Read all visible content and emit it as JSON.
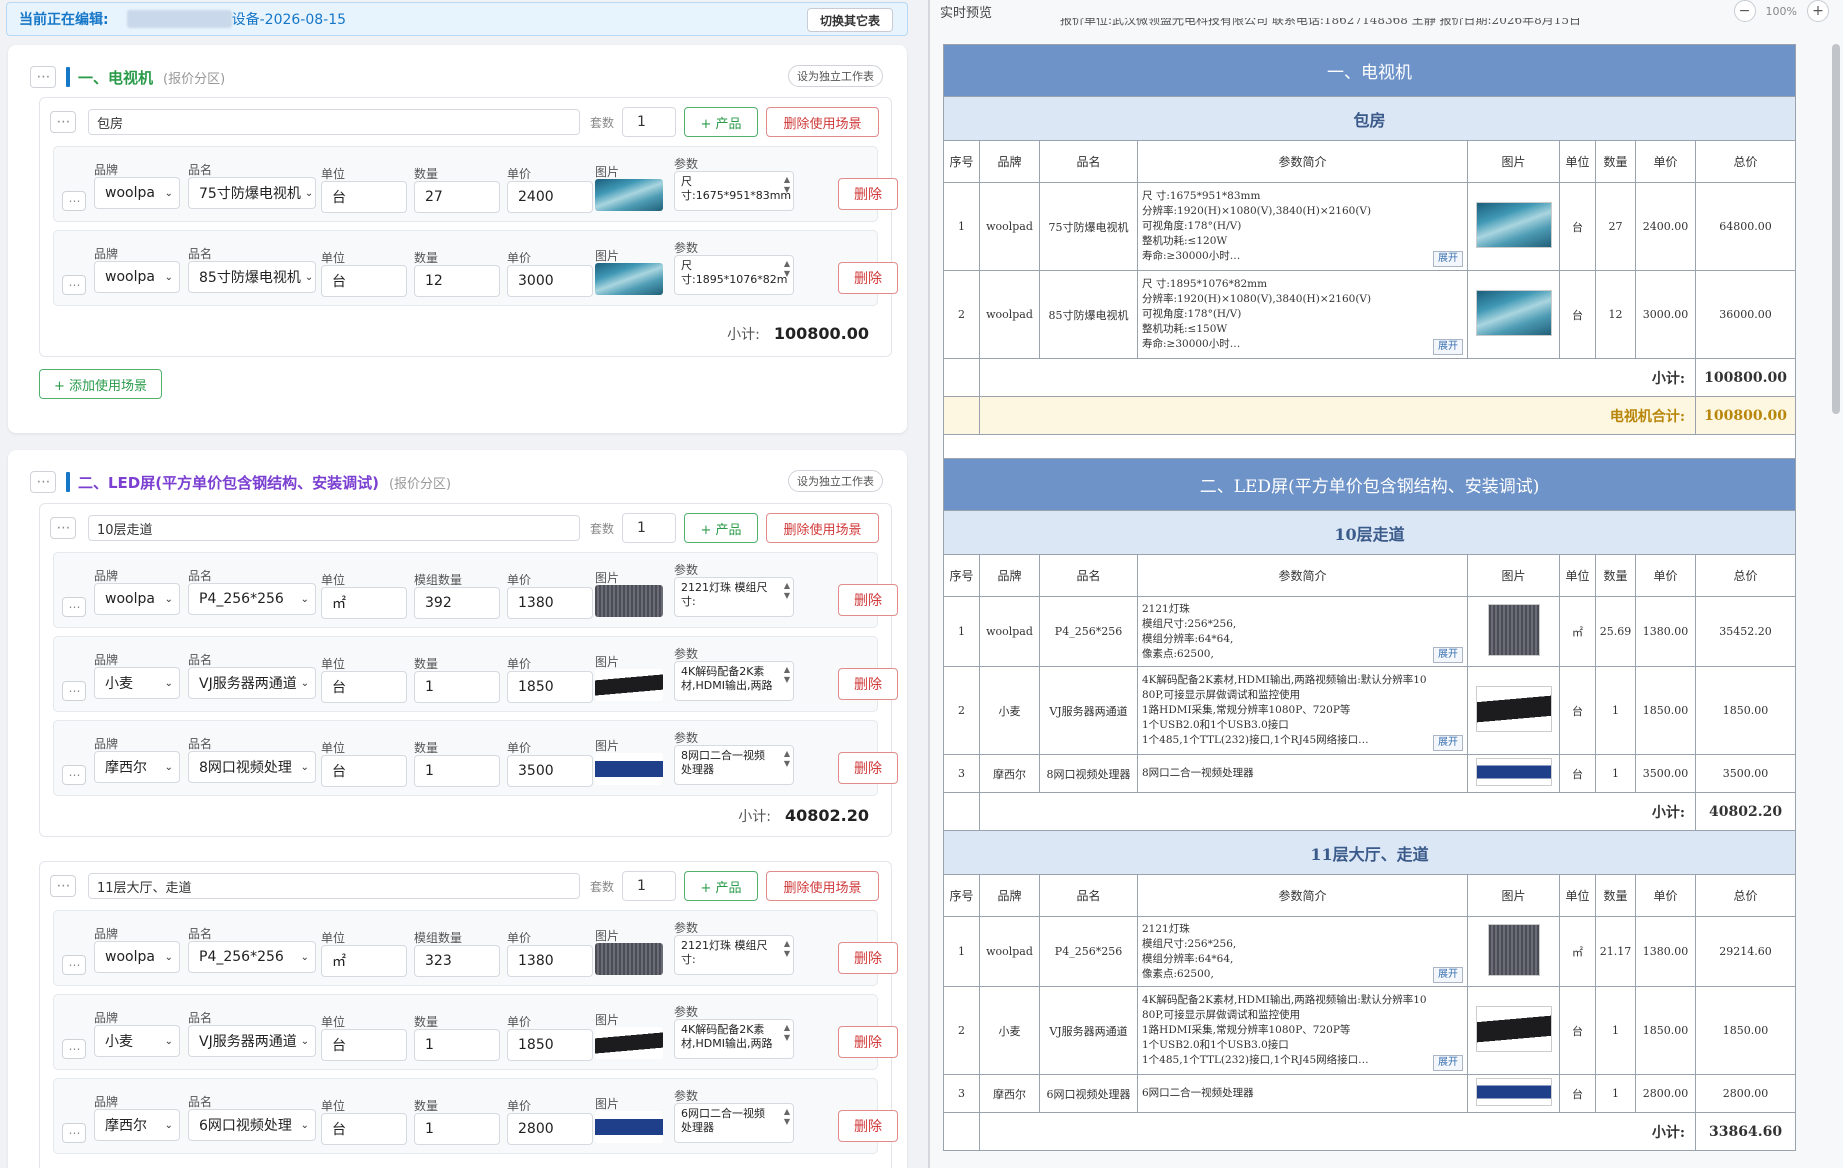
{
  "editing": {
    "label": "当前正在编辑:",
    "name": "设备-2026-08-15",
    "switch_btn": "切换其它表"
  },
  "common": {
    "more": "⋯",
    "brand": "品牌",
    "product": "品名",
    "unit": "单位",
    "qty": "数量",
    "module_qty": "模组数量",
    "price": "单价",
    "image": "图片",
    "params": "参数",
    "delete": "删除",
    "sets": "套数",
    "add_product": "+ 产品",
    "delete_scene": "删除使用场景",
    "subtotal": "小计:",
    "indep": "设为独立工作表",
    "section_tag": "(报价分区)",
    "add_scene": "+ 添加使用场景"
  },
  "colors": {
    "sec1": "#2b9b4a",
    "sec2": "#7b3fd1",
    "bar1": "#1677c8",
    "bar2": "#1677c8"
  },
  "sec1": {
    "title": "一、电视机",
    "scene": {
      "name": "包房",
      "sets": "1",
      "subtotal": "100800.00",
      "items": [
        {
          "brand": "woolpa",
          "product": "75寸防爆电视机",
          "unit": "台",
          "qty": "27",
          "price": "2400",
          "image": "tv-ocean-image",
          "param": "尺  寸:1675*951*83mm"
        },
        {
          "brand": "woolpa",
          "product": "85寸防爆电视机",
          "unit": "台",
          "qty": "12",
          "price": "3000",
          "image": "tv-ocean-image",
          "param": "尺  寸:1895*1076*82m"
        }
      ]
    }
  },
  "sec2": {
    "title": "二、LED屏(平方单价包含钢结构、安装调试)",
    "scene1": {
      "name": "10层走道",
      "sets": "1",
      "subtotal": "40802.20",
      "items": [
        {
          "brand": "woolpa",
          "product": "P4_256*256",
          "unit": "㎡",
          "qty": "392",
          "price": "1380",
          "image": "led-module-image",
          "param": "2121灯珠 模组尺寸:"
        },
        {
          "brand": "小麦",
          "product": "VJ服务器两通道",
          "unit": "台",
          "qty": "1",
          "price": "1850",
          "image": "server-image",
          "param": "4K解码配备2K素材,HDMI输出,两路"
        },
        {
          "brand": "摩西尔",
          "product": "8网口视频处理",
          "unit": "台",
          "qty": "1",
          "price": "3500",
          "image": "processor-image",
          "param": "8网口二合一视频处理器"
        }
      ]
    },
    "scene2": {
      "name": "11层大厅、走道",
      "sets": "1",
      "subtotal": "33864.60",
      "items": [
        {
          "brand": "woolpa",
          "product": "P4_256*256",
          "unit": "㎡",
          "qty": "323",
          "price": "1380",
          "image": "led-module-image",
          "param": "2121灯珠 模组尺寸:"
        },
        {
          "brand": "小麦",
          "product": "VJ服务器两通道",
          "unit": "台",
          "qty": "1",
          "price": "1850",
          "image": "server-image",
          "param": "4K解码配备2K素材,HDMI输出,两路"
        },
        {
          "brand": "摩西尔",
          "product": "6网口视频处理",
          "unit": "台",
          "qty": "1",
          "price": "2800",
          "image": "processor-image",
          "param": "6网口二合一视频处理器"
        }
      ]
    }
  },
  "preview": {
    "title": "实时预览",
    "zoom": "100%",
    "cut_header": "报价单位:武汉微领盟光电科技有限公司      联系电话:18627148368 王静      报价日期:2026年8月15日",
    "cols": {
      "seq": "序号",
      "brand": "品牌",
      "product": "品名",
      "params": "参数简介",
      "image": "图片",
      "unit": "单位",
      "qty": "数量",
      "price": "单价",
      "total": "总价"
    },
    "expand": "展开",
    "subtotal_label": "小计:",
    "sec1": {
      "title": "一、电视机",
      "total_label": "电视机合计:",
      "total": "100800.00",
      "scene": {
        "name": "包房",
        "subtotal": "100800.00",
        "rows": [
          {
            "seq": "1",
            "brand": "woolpad",
            "product": "75寸防爆电视机",
            "params": [
              "尺  寸:1675*951*83mm",
              "分辨率:1920(H)×1080(V),3840(H)×2160(V)",
              "可视角度:178°(H/V)",
              "整机功耗:≤120W",
              "寿命:≥30000小时…"
            ],
            "unit": "台",
            "qty": "27",
            "price": "2400.00",
            "total": "64800.00"
          },
          {
            "seq": "2",
            "brand": "woolpad",
            "product": "85寸防爆电视机",
            "params": [
              "尺  寸:1895*1076*82mm",
              "分辨率:1920(H)×1080(V),3840(H)×2160(V)",
              "可视角度:178°(H/V)",
              "整机功耗:≤150W",
              "寿命:≥30000小时…"
            ],
            "unit": "台",
            "qty": "12",
            "price": "3000.00",
            "total": "36000.00"
          }
        ]
      }
    },
    "sec2": {
      "title": "二、LED屏(平方单价包含钢结构、安装调试)",
      "scene1": {
        "name": "10层走道",
        "subtotal": "40802.20",
        "rows": [
          {
            "seq": "1",
            "brand": "woolpad",
            "product": "P4_256*256",
            "params": [
              "2121灯珠",
              "模组尺寸:256*256,",
              "模组分辨率:64*64,",
              "像素点:62500,"
            ],
            "unit": "㎡",
            "qty": "25.69",
            "price": "1380.00",
            "total": "35452.20"
          },
          {
            "seq": "2",
            "brand": "小麦",
            "product": "VJ服务器两通道",
            "params": [
              "4K解码配备2K素材,HDMI输出,两路视频输出:默认分辨率10",
              "80P,可接显示屏做调试和监控使用",
              "1路HDMI采集,常规分辨率1080P、720P等",
              "1个USB2.0和1个USB3.0接口",
              "1个485,1个TTL(232)接口,1个RJ45网络接口…"
            ],
            "unit": "台",
            "qty": "1",
            "price": "1850.00",
            "total": "1850.00"
          },
          {
            "seq": "3",
            "brand": "摩西尔",
            "product": "8网口视频处理器",
            "params": [
              "8网口二合一视频处理器"
            ],
            "unit": "台",
            "qty": "1",
            "price": "3500.00",
            "total": "3500.00"
          }
        ]
      },
      "scene2": {
        "name": "11层大厅、走道",
        "subtotal": "33864.60",
        "rows": [
          {
            "seq": "1",
            "brand": "woolpad",
            "product": "P4_256*256",
            "params": [
              "2121灯珠",
              "模组尺寸:256*256,",
              "模组分辨率:64*64,",
              "像素点:62500,"
            ],
            "unit": "㎡",
            "qty": "21.17",
            "price": "1380.00",
            "total": "29214.60"
          },
          {
            "seq": "2",
            "brand": "小麦",
            "product": "VJ服务器两通道",
            "params": [
              "4K解码配备2K素材,HDMI输出,两路视频输出:默认分辨率10",
              "80P,可接显示屏做调试和监控使用",
              "1路HDMI采集,常规分辨率1080P、720P等",
              "1个USB2.0和1个USB3.0接口",
              "1个485,1个TTL(232)接口,1个RJ45网络接口…"
            ],
            "unit": "台",
            "qty": "1",
            "price": "1850.00",
            "total": "1850.00"
          },
          {
            "seq": "3",
            "brand": "摩西尔",
            "product": "6网口视频处理器",
            "params": [
              "6网口二合一视频处理器"
            ],
            "unit": "台",
            "qty": "1",
            "price": "2800.00",
            "total": "2800.00"
          }
        ]
      }
    }
  }
}
